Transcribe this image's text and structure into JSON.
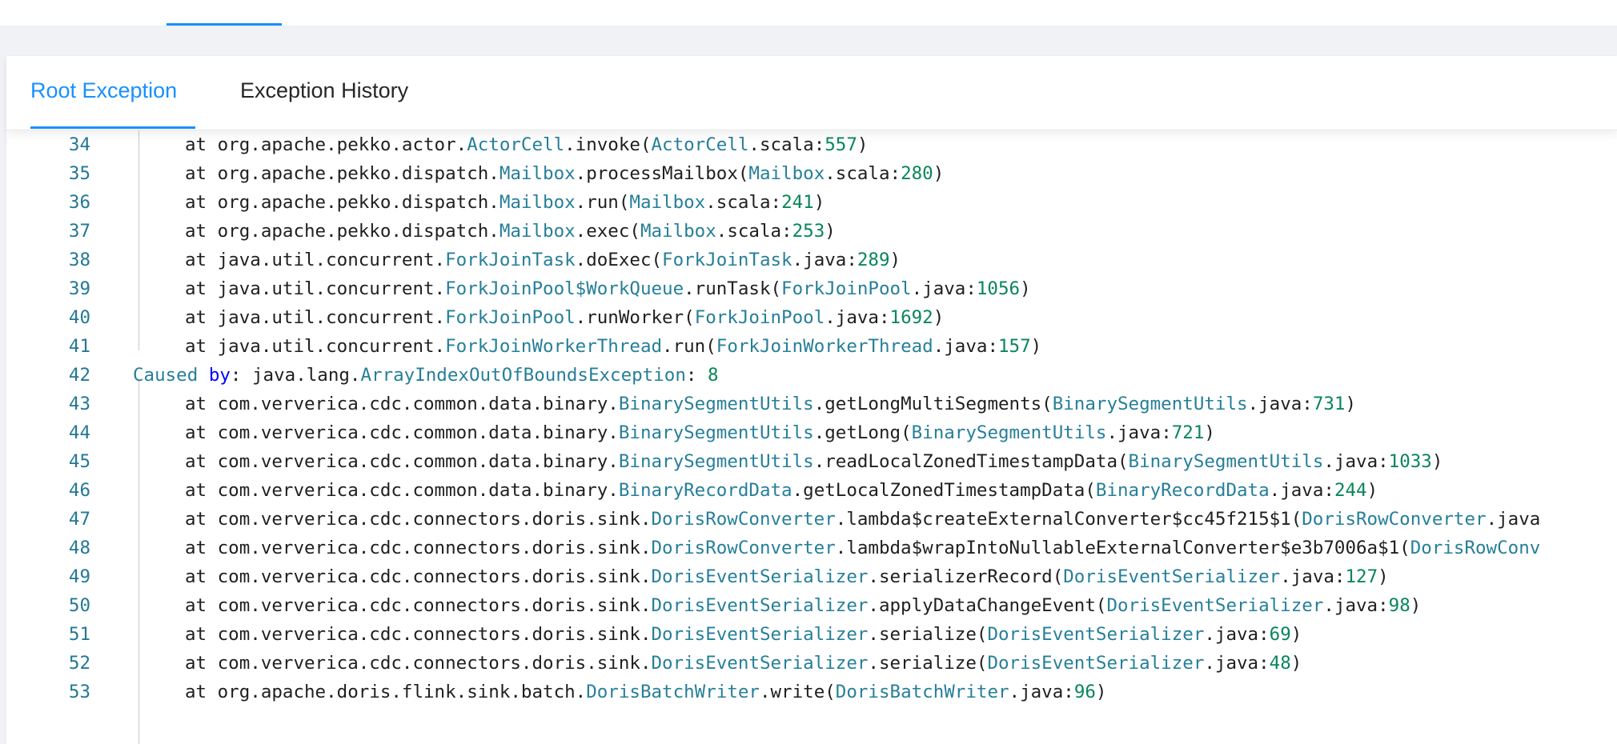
{
  "top_tabs": {
    "active_fragment": "",
    "other_fragment": ""
  },
  "tabs": [
    {
      "label": "Root Exception",
      "active": true
    },
    {
      "label": "Exception History",
      "active": false
    }
  ],
  "colors": {
    "accent": "#1890ff",
    "class_name": "#267f99",
    "number": "#098658",
    "keyword": "#0000ff",
    "line_number": "#237893"
  },
  "code_lines": [
    {
      "n": 34,
      "indent": true,
      "parts": [
        [
          "at org.apache.pekko.actor.",
          ""
        ],
        [
          "ActorCell",
          "cls"
        ],
        [
          ".invoke(",
          ""
        ],
        [
          "ActorCell",
          "cls"
        ],
        [
          ".scala:",
          ""
        ],
        [
          "557",
          "num"
        ],
        [
          ")",
          ""
        ]
      ]
    },
    {
      "n": 35,
      "indent": true,
      "parts": [
        [
          "at org.apache.pekko.dispatch.",
          ""
        ],
        [
          "Mailbox",
          "cls"
        ],
        [
          ".processMailbox(",
          ""
        ],
        [
          "Mailbox",
          "cls"
        ],
        [
          ".scala:",
          ""
        ],
        [
          "280",
          "num"
        ],
        [
          ")",
          ""
        ]
      ]
    },
    {
      "n": 36,
      "indent": true,
      "parts": [
        [
          "at org.apache.pekko.dispatch.",
          ""
        ],
        [
          "Mailbox",
          "cls"
        ],
        [
          ".run(",
          ""
        ],
        [
          "Mailbox",
          "cls"
        ],
        [
          ".scala:",
          ""
        ],
        [
          "241",
          "num"
        ],
        [
          ")",
          ""
        ]
      ]
    },
    {
      "n": 37,
      "indent": true,
      "parts": [
        [
          "at org.apache.pekko.dispatch.",
          ""
        ],
        [
          "Mailbox",
          "cls"
        ],
        [
          ".exec(",
          ""
        ],
        [
          "Mailbox",
          "cls"
        ],
        [
          ".scala:",
          ""
        ],
        [
          "253",
          "num"
        ],
        [
          ")",
          ""
        ]
      ]
    },
    {
      "n": 38,
      "indent": true,
      "parts": [
        [
          "at java.util.concurrent.",
          ""
        ],
        [
          "ForkJoinTask",
          "cls"
        ],
        [
          ".doExec(",
          ""
        ],
        [
          "ForkJoinTask",
          "cls"
        ],
        [
          ".java:",
          ""
        ],
        [
          "289",
          "num"
        ],
        [
          ")",
          ""
        ]
      ]
    },
    {
      "n": 39,
      "indent": true,
      "parts": [
        [
          "at java.util.concurrent.",
          ""
        ],
        [
          "ForkJoinPool$WorkQueue",
          "cls"
        ],
        [
          ".runTask(",
          ""
        ],
        [
          "ForkJoinPool",
          "cls"
        ],
        [
          ".java:",
          ""
        ],
        [
          "1056",
          "num"
        ],
        [
          ")",
          ""
        ]
      ]
    },
    {
      "n": 40,
      "indent": true,
      "parts": [
        [
          "at java.util.concurrent.",
          ""
        ],
        [
          "ForkJoinPool",
          "cls"
        ],
        [
          ".runWorker(",
          ""
        ],
        [
          "ForkJoinPool",
          "cls"
        ],
        [
          ".java:",
          ""
        ],
        [
          "1692",
          "num"
        ],
        [
          ")",
          ""
        ]
      ]
    },
    {
      "n": 41,
      "indent": true,
      "parts": [
        [
          "at java.util.concurrent.",
          ""
        ],
        [
          "ForkJoinWorkerThread",
          "cls"
        ],
        [
          ".run(",
          ""
        ],
        [
          "ForkJoinWorkerThread",
          "cls"
        ],
        [
          ".java:",
          ""
        ],
        [
          "157",
          "num"
        ],
        [
          ")",
          ""
        ]
      ]
    },
    {
      "n": 42,
      "indent": false,
      "parts": [
        [
          "Caused",
          "cause"
        ],
        [
          " ",
          ""
        ],
        [
          "by",
          "kw"
        ],
        [
          ": java.lang.",
          ""
        ],
        [
          "ArrayIndexOutOfBoundsException",
          "cls"
        ],
        [
          ": ",
          ""
        ],
        [
          "8",
          "num"
        ]
      ]
    },
    {
      "n": 43,
      "indent": true,
      "parts": [
        [
          "at com.ververica.cdc.common.data.binary.",
          ""
        ],
        [
          "BinarySegmentUtils",
          "cls"
        ],
        [
          ".getLongMultiSegments(",
          ""
        ],
        [
          "BinarySegmentUtils",
          "cls"
        ],
        [
          ".java:",
          ""
        ],
        [
          "731",
          "num"
        ],
        [
          ")",
          ""
        ]
      ]
    },
    {
      "n": 44,
      "indent": true,
      "parts": [
        [
          "at com.ververica.cdc.common.data.binary.",
          ""
        ],
        [
          "BinarySegmentUtils",
          "cls"
        ],
        [
          ".getLong(",
          ""
        ],
        [
          "BinarySegmentUtils",
          "cls"
        ],
        [
          ".java:",
          ""
        ],
        [
          "721",
          "num"
        ],
        [
          ")",
          ""
        ]
      ]
    },
    {
      "n": 45,
      "indent": true,
      "parts": [
        [
          "at com.ververica.cdc.common.data.binary.",
          ""
        ],
        [
          "BinarySegmentUtils",
          "cls"
        ],
        [
          ".readLocalZonedTimestampData(",
          ""
        ],
        [
          "BinarySegmentUtils",
          "cls"
        ],
        [
          ".java:",
          ""
        ],
        [
          "1033",
          "num"
        ],
        [
          ")",
          ""
        ]
      ]
    },
    {
      "n": 46,
      "indent": true,
      "parts": [
        [
          "at com.ververica.cdc.common.data.binary.",
          ""
        ],
        [
          "BinaryRecordData",
          "cls"
        ],
        [
          ".getLocalZonedTimestampData(",
          ""
        ],
        [
          "BinaryRecordData",
          "cls"
        ],
        [
          ".java:",
          ""
        ],
        [
          "244",
          "num"
        ],
        [
          ")",
          ""
        ]
      ]
    },
    {
      "n": 47,
      "indent": true,
      "parts": [
        [
          "at com.ververica.cdc.connectors.doris.sink.",
          ""
        ],
        [
          "DorisRowConverter",
          "cls"
        ],
        [
          ".lambda$createExternalConverter$cc45f215$1(",
          ""
        ],
        [
          "DorisRowConverter",
          "cls"
        ],
        [
          ".java",
          ""
        ]
      ]
    },
    {
      "n": 48,
      "indent": true,
      "parts": [
        [
          "at com.ververica.cdc.connectors.doris.sink.",
          ""
        ],
        [
          "DorisRowConverter",
          "cls"
        ],
        [
          ".lambda$wrapIntoNullableExternalConverter$e3b7006a$1(",
          ""
        ],
        [
          "DorisRowConv",
          "cls"
        ]
      ]
    },
    {
      "n": 49,
      "indent": true,
      "parts": [
        [
          "at com.ververica.cdc.connectors.doris.sink.",
          ""
        ],
        [
          "DorisEventSerializer",
          "cls"
        ],
        [
          ".serializerRecord(",
          ""
        ],
        [
          "DorisEventSerializer",
          "cls"
        ],
        [
          ".java:",
          ""
        ],
        [
          "127",
          "num"
        ],
        [
          ")",
          ""
        ]
      ]
    },
    {
      "n": 50,
      "indent": true,
      "parts": [
        [
          "at com.ververica.cdc.connectors.doris.sink.",
          ""
        ],
        [
          "DorisEventSerializer",
          "cls"
        ],
        [
          ".applyDataChangeEvent(",
          ""
        ],
        [
          "DorisEventSerializer",
          "cls"
        ],
        [
          ".java:",
          ""
        ],
        [
          "98",
          "num"
        ],
        [
          ")",
          ""
        ]
      ]
    },
    {
      "n": 51,
      "indent": true,
      "parts": [
        [
          "at com.ververica.cdc.connectors.doris.sink.",
          ""
        ],
        [
          "DorisEventSerializer",
          "cls"
        ],
        [
          ".serialize(",
          ""
        ],
        [
          "DorisEventSerializer",
          "cls"
        ],
        [
          ".java:",
          ""
        ],
        [
          "69",
          "num"
        ],
        [
          ")",
          ""
        ]
      ]
    },
    {
      "n": 52,
      "indent": true,
      "parts": [
        [
          "at com.ververica.cdc.connectors.doris.sink.",
          ""
        ],
        [
          "DorisEventSerializer",
          "cls"
        ],
        [
          ".serialize(",
          ""
        ],
        [
          "DorisEventSerializer",
          "cls"
        ],
        [
          ".java:",
          ""
        ],
        [
          "48",
          "num"
        ],
        [
          ")",
          ""
        ]
      ]
    },
    {
      "n": 53,
      "indent": true,
      "parts": [
        [
          "at org.apache.doris.flink.sink.batch.",
          ""
        ],
        [
          "DorisBatchWriter",
          "cls"
        ],
        [
          ".write(",
          ""
        ],
        [
          "DorisBatchWriter",
          "cls"
        ],
        [
          ".java:",
          ""
        ],
        [
          "96",
          "num"
        ],
        [
          ")",
          ""
        ]
      ]
    }
  ]
}
